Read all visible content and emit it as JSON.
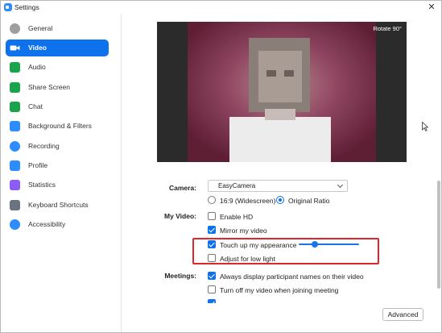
{
  "window": {
    "title": "Settings",
    "close_glyph": "✕"
  },
  "sidebar": {
    "items": [
      {
        "label": "General",
        "icon": "gear-icon",
        "color": "#9e9e9e"
      },
      {
        "label": "Video",
        "icon": "video-camera-icon",
        "color": "#ffffff",
        "active": true
      },
      {
        "label": "Audio",
        "icon": "headphones-icon",
        "color": "#1aa34a"
      },
      {
        "label": "Share Screen",
        "icon": "share-screen-icon",
        "color": "#1aa34a"
      },
      {
        "label": "Chat",
        "icon": "chat-bubble-icon",
        "color": "#1aa34a"
      },
      {
        "label": "Background & Filters",
        "icon": "person-background-icon",
        "color": "#2d8cff"
      },
      {
        "label": "Recording",
        "icon": "record-icon",
        "color": "#2d8cff"
      },
      {
        "label": "Profile",
        "icon": "person-icon",
        "color": "#2d8cff"
      },
      {
        "label": "Statistics",
        "icon": "statistics-icon",
        "color": "#8b5cf6"
      },
      {
        "label": "Keyboard Shortcuts",
        "icon": "keyboard-icon",
        "color": "#6b7280"
      },
      {
        "label": "Accessibility",
        "icon": "accessibility-icon",
        "color": "#2d8cff"
      }
    ]
  },
  "video": {
    "preview_rotate": "Rotate 90°",
    "camera_label": "Camera:",
    "camera_value": "EasyCamera",
    "ratio_options": [
      {
        "label": "16:9 (Widescreen)",
        "selected": false
      },
      {
        "label": "Original Ratio",
        "selected": true
      }
    ],
    "my_video_label": "My Video:",
    "my_video_options": [
      {
        "label": "Enable HD",
        "checked": false
      },
      {
        "label": "Mirror my video",
        "checked": true
      },
      {
        "label": "Touch up my appearance",
        "checked": true
      },
      {
        "label": "Adjust for low light",
        "checked": false
      }
    ],
    "touch_up_level": 0.27,
    "meetings_label": "Meetings:",
    "meetings_options": [
      {
        "label": "Always display participant names on their video",
        "checked": true
      },
      {
        "label": "Turn off my video when joining meeting",
        "checked": false
      }
    ],
    "advanced_label": "Advanced"
  },
  "colors": {
    "accent": "#0e72ed",
    "highlight_border": "#e0262a"
  }
}
